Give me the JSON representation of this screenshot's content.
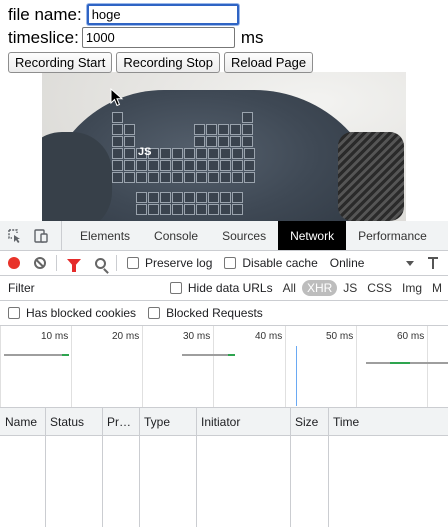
{
  "page": {
    "file_label": "file name:",
    "file_value": "hoge",
    "timeslice_label": "timeslice:",
    "timeslice_value": "1000",
    "timeslice_unit": "ms",
    "buttons": {
      "start": "Recording Start",
      "stop": "Recording Stop",
      "reload": "Reload Page"
    },
    "video": {
      "shirt_print_glyph": "JS"
    }
  },
  "devtools": {
    "tabs": [
      "Elements",
      "Console",
      "Sources",
      "Network",
      "Performance"
    ],
    "active_tab": "Network",
    "toolbar": {
      "record_icon": "record-icon",
      "clear_icon": "clear-icon",
      "filter_icon": "funnel-icon",
      "search_icon": "search-icon",
      "preserve_log": "Preserve log",
      "disable_cache": "Disable cache",
      "throttling": "Online"
    },
    "filter_bar": {
      "placeholder": "Filter",
      "hide_data_urls": "Hide data URLs",
      "types": [
        "All",
        "XHR",
        "JS",
        "CSS",
        "Img",
        "M"
      ],
      "selected_type": "XHR"
    },
    "blocked_bar": {
      "has_blocked_cookies": "Has blocked cookies",
      "blocked_requests": "Blocked Requests"
    },
    "overview": {
      "ticks": [
        "10 ms",
        "20 ms",
        "30 ms",
        "40 ms",
        "50 ms",
        "60 ms"
      ]
    },
    "columns": [
      "Name",
      "Status",
      "Pr…",
      "Type",
      "Initiator",
      "Size",
      "Time"
    ]
  },
  "colors": {
    "record": "#e8332a",
    "filter_active": "#e52b2b",
    "active_tab_bg": "#000000",
    "focus_ring": "#2f64c4",
    "timing_blue": "#6aa9f3",
    "timing_green": "#2ea44f"
  }
}
